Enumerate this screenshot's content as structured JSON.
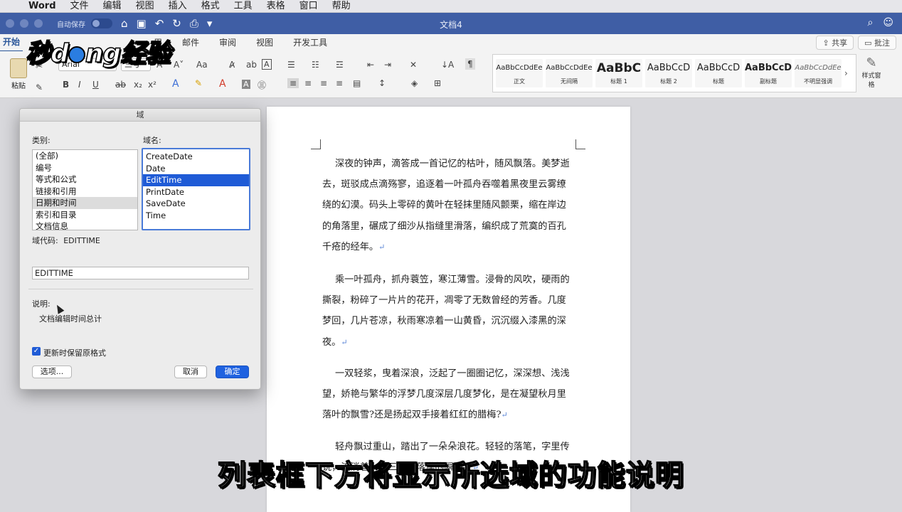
{
  "menubar": {
    "app": "Word",
    "items": [
      "文件",
      "编辑",
      "视图",
      "插入",
      "格式",
      "工具",
      "表格",
      "窗口",
      "帮助"
    ]
  },
  "titlebar": {
    "autosave_label": "自动保存",
    "doc_title": "文档4"
  },
  "ribbon_tabs": {
    "tabs": [
      "开始",
      "用",
      "邮件",
      "审阅",
      "视图",
      "开发工具"
    ],
    "share": "共享",
    "comments": "批注"
  },
  "ribbon": {
    "paste_label": "粘贴",
    "font_name": "Arial",
    "font_size": "三号",
    "change_case": "Aa",
    "styles": [
      {
        "sample": "AaBbCcDdEe",
        "name": "正文"
      },
      {
        "sample": "AaBbCcDdEe",
        "name": "无间隔"
      },
      {
        "sample": "AaBbC",
        "name": "标题 1"
      },
      {
        "sample": "AaBbCcD",
        "name": "标题 2"
      },
      {
        "sample": "AaBbCcD",
        "name": "标题"
      },
      {
        "sample": "AaBbCcD",
        "name": "副标题"
      },
      {
        "sample": "AaBbCcDdEe",
        "name": "不明显强调"
      }
    ],
    "style_pane": "样式窗格"
  },
  "document": {
    "paragraphs": [
      "深夜的钟声，滴答成一首记忆的枯叶，随风飘落。美梦逝去，斑驳成点滴殇寥，追逐着一叶孤舟吞噬着黑夜里云雾缭绕的幻漠。码头上零碎的黄叶在轻抹里随风颤栗，缩在岸边的角落里，碾成了细沙从指缝里滑落，编织成了荒寞的百孔千疮的经年。",
      "乘一叶孤舟，抓舟蓑笠，寒江薄雪。浸骨的风吹，硬雨的撕裂，粉碎了一片片的花开，凋零了无数曾经的芳香。几度梦回，几片苍凉，秋雨寒凉着一山黄昏，沉沉缀入漆黑的深夜。",
      "一双轻浆，曳着深浪，泛起了一圈圈记忆，深深想、浅浅望，娇艳与繁华的浮梦几度深层几度梦化，是在凝望秋月里落叶的飘雪?还是扬起双手接着红红的腊梅?",
      "轻舟飘过重山，踏出了一朵朵浪花。轻轻的落笔，字里传说，流淌着一生三世的落漠的瞬间。"
    ]
  },
  "dialog": {
    "title": "域",
    "category_label": "类别:",
    "categories": [
      "(全部)",
      "编号",
      "等式和公式",
      "链接和引用",
      "日期和时间",
      "索引和目录",
      "文档信息"
    ],
    "selected_category": "日期和时间",
    "field_names_label": "域名:",
    "field_names": [
      "CreateDate",
      "Date",
      "EditTime",
      "PrintDate",
      "SaveDate",
      "Time"
    ],
    "selected_field": "EditTime",
    "field_code_label": "域代码:",
    "field_code_value": "EDITTIME",
    "field_code_input": "EDITTIME",
    "description_label": "说明:",
    "description_text": "文档编辑时间总计",
    "preserve_format_label": "更新时保留原格式",
    "preserve_format_checked": true,
    "options_button": "选项...",
    "cancel_button": "取消",
    "ok_button": "确定"
  },
  "caption": "列表框下方将显示所选域的功能说明",
  "watermark": "秒懂经验"
}
